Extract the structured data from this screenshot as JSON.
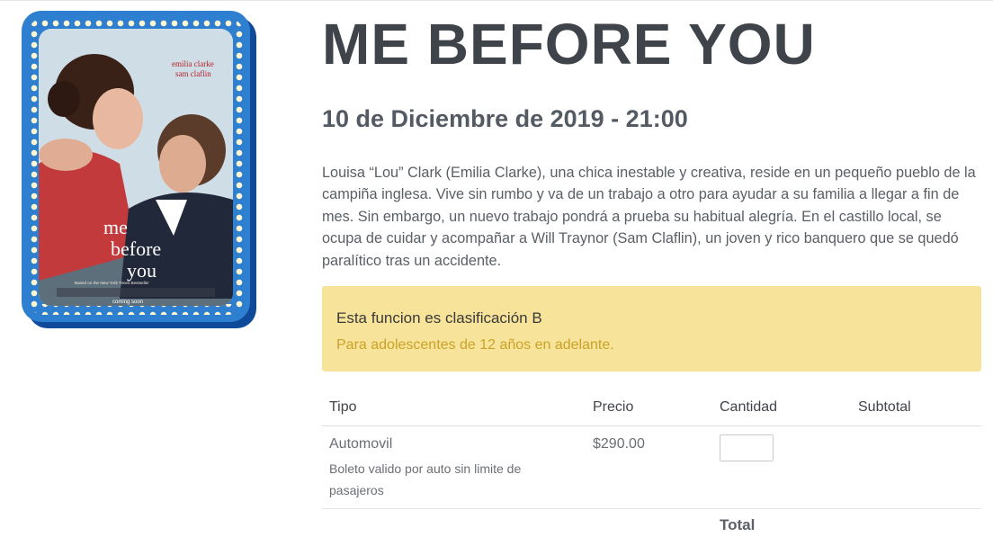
{
  "movie": {
    "title": "ME BEFORE YOU",
    "showtime": "10 de Diciembre de 2019 - 21:00",
    "synopsis": "Louisa “Lou” Clark (Emilia Clarke), una chica inestable y creativa, reside en un pequeño pueblo de la campiña inglesa. Vive sin rumbo y va de un trabajo a otro para ayudar a su familia a llegar a fin de mes. Sin embargo, un nuevo trabajo pondrá a prueba su habitual alegría. En el castillo local, se ocupa de cuidar y acompañar a Will Traynor (Sam Claflin), un joven y rico banquero que se quedó paralítico tras un accidente."
  },
  "poster": {
    "actor1": "emilia clarke",
    "actor2": "sam claflin",
    "title_line1": "me",
    "title_line2": "before",
    "title_line3": "you",
    "tagline": "Based on the New York Times Bestseller",
    "footer": "coming soon"
  },
  "rating": {
    "title": "Esta funcion es clasificación B",
    "description": "Para adolescentes de 12 años en adelante."
  },
  "table": {
    "headers": {
      "type": "Tipo",
      "price": "Precio",
      "quantity": "Cantidad",
      "subtotal": "Subtotal"
    },
    "rows": [
      {
        "name": "Automovil",
        "description": "Boleto valido por auto sin limite de pasajeros",
        "price": "$290.00",
        "quantity": "",
        "subtotal": ""
      }
    ],
    "total_label": "Total"
  },
  "colors": {
    "alert_bg": "#f8e39a",
    "alert_text": "#c9a227",
    "poster_frame": "#2f7fd0"
  }
}
